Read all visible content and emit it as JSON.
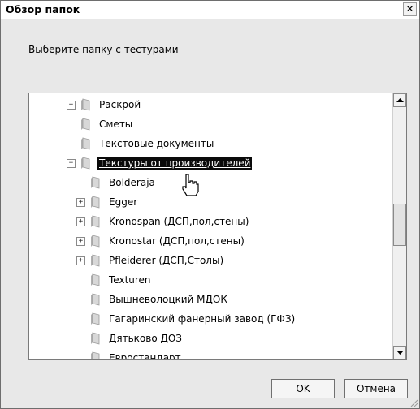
{
  "dialog": {
    "title": "Обзор папок",
    "close_glyph": "✕",
    "instruction": "Выберите папку с тестурами"
  },
  "tree": {
    "items": [
      {
        "label": "Раскрой",
        "level": 1,
        "expander": "+",
        "selected": false
      },
      {
        "label": "Сметы",
        "level": 1,
        "expander": "",
        "selected": false
      },
      {
        "label": "Текстовые документы",
        "level": 1,
        "expander": "",
        "selected": false
      },
      {
        "label": "Текстуры от производителей",
        "level": 1,
        "expander": "−",
        "selected": true
      },
      {
        "label": "Bolderaja",
        "level": 2,
        "expander": "",
        "selected": false
      },
      {
        "label": "Egger",
        "level": 2,
        "expander": "+",
        "selected": false
      },
      {
        "label": "Kronospan  (ДСП,пол,стены)",
        "level": 2,
        "expander": "+",
        "selected": false
      },
      {
        "label": "Kronostar (ДСП,пол,стены)",
        "level": 2,
        "expander": "+",
        "selected": false
      },
      {
        "label": "Pfleiderer (ДСП,Столы)",
        "level": 2,
        "expander": "+",
        "selected": false
      },
      {
        "label": "Texturen",
        "level": 2,
        "expander": "",
        "selected": false
      },
      {
        "label": "Вышневолоцкий МДОК",
        "level": 2,
        "expander": "",
        "selected": false
      },
      {
        "label": "Гагаринский фанерный завод (ГФЗ)",
        "level": 2,
        "expander": "",
        "selected": false
      },
      {
        "label": "Дятьково ДОЗ",
        "level": 2,
        "expander": "",
        "selected": false
      },
      {
        "label": "Евростандарт",
        "level": 2,
        "expander": "",
        "selected": false
      }
    ]
  },
  "buttons": {
    "ok": "OK",
    "cancel": "Отмена"
  },
  "colors": {
    "selection": "#0a0a0a",
    "folder": "#c9c9c9"
  },
  "icons": {
    "folder": "folder-icon",
    "cursor": "hand-cursor-icon"
  }
}
